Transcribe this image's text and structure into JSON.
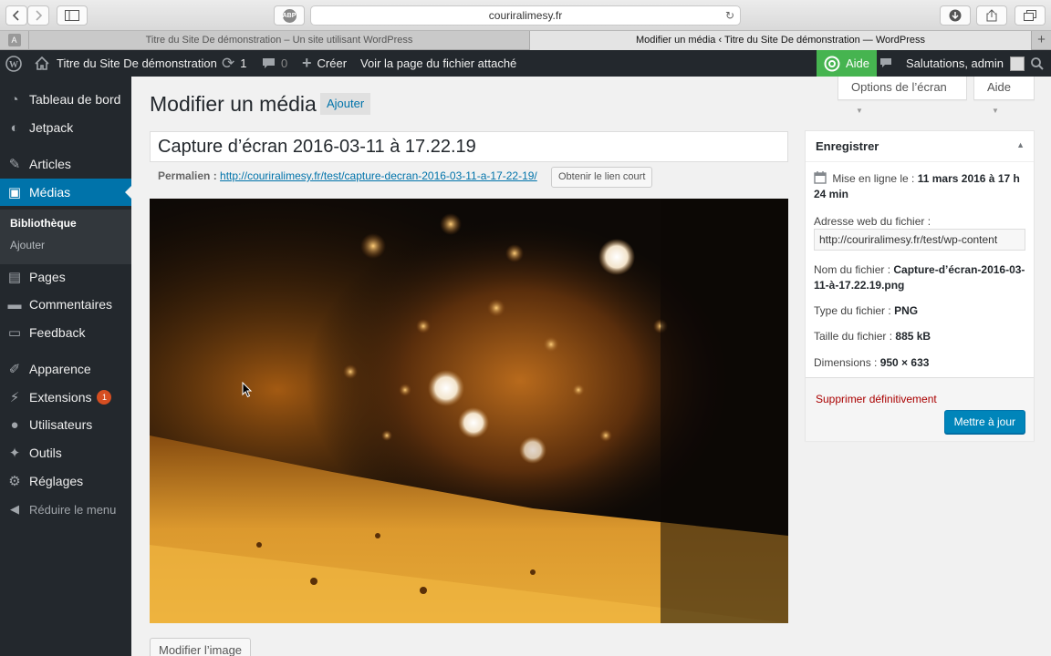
{
  "browser": {
    "url": "couriralimesy.fr",
    "tabs": [
      "Titre du Site De démonstration – Un site utilisant WordPress",
      "Modifier un média ‹ Titre du Site De démonstration — WordPress"
    ],
    "abp_label": "ABP",
    "tab_favicon": "A",
    "new_tab": "+"
  },
  "adminbar": {
    "site_name": "Titre du Site De démonstration",
    "updates_count": "1",
    "comments_count": "0",
    "new_label": "Créer",
    "view_attachment": "Voir la page du fichier attaché",
    "help_label": "Aide",
    "greeting": "Salutations, admin"
  },
  "sidebar": {
    "items": [
      {
        "label": "Tableau de bord",
        "icon": "dashboard-icon"
      },
      {
        "label": "Jetpack",
        "icon": "jetpack-icon"
      },
      {
        "label": "Articles",
        "icon": "pin-icon"
      },
      {
        "label": "Médias",
        "icon": "media-icon"
      },
      {
        "label": "Pages",
        "icon": "pages-icon"
      },
      {
        "label": "Commentaires",
        "icon": "comments-icon"
      },
      {
        "label": "Feedback",
        "icon": "feedback-icon"
      },
      {
        "label": "Apparence",
        "icon": "appearance-icon"
      },
      {
        "label": "Extensions",
        "icon": "plugins-icon",
        "badge": "1"
      },
      {
        "label": "Utilisateurs",
        "icon": "users-icon"
      },
      {
        "label": "Outils",
        "icon": "tools-icon"
      },
      {
        "label": "Réglages",
        "icon": "settings-icon"
      }
    ],
    "submenu": [
      "Bibliothèque",
      "Ajouter"
    ],
    "collapse": "Réduire le menu"
  },
  "header": {
    "screen_options": "Options de l’écran",
    "help": "Aide",
    "title": "Modifier un média",
    "add_new": "Ajouter"
  },
  "editor": {
    "title_value": "Capture d’écran 2016-03-11 à 17.22.19",
    "permalink_label": "Permalien :",
    "permalink_url": "http://couriralimesy.fr/test/capture-decran-2016-03-11-a-17-22-19/",
    "shortlink_button": "Obtenir le lien court",
    "edit_image_button": "Modifier l’image"
  },
  "publish": {
    "heading": "Enregistrer",
    "published_label": "Mise en ligne le :",
    "published_value": "11 mars 2016 à 17 h 24 min",
    "file_url_label": "Adresse web du fichier :",
    "file_url_value": "http://couriralimesy.fr/test/wp-content",
    "filename_label": "Nom du fichier :",
    "filename_value": "Capture-d’écran-2016-03-11-à-17.22.19.png",
    "filetype_label": "Type du fichier :",
    "filetype_value": "PNG",
    "filesize_label": "Taille du fichier :",
    "filesize_value": "885 kB",
    "dimensions_label": "Dimensions :",
    "dimensions_value": "950 × 633",
    "delete_link": "Supprimer définitivement",
    "update_button": "Mettre à jour"
  },
  "colors": {
    "accent": "#0073aa",
    "adminbar": "#23282d",
    "help_green": "#46b450",
    "delete_red": "#aa0000",
    "badge": "#d54e21"
  }
}
